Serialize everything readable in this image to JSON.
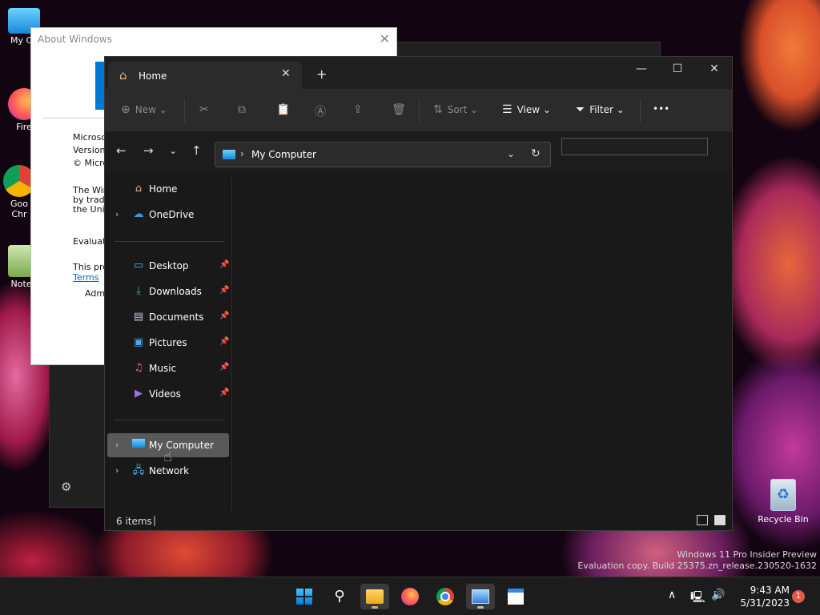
{
  "desktop": {
    "icons": [
      {
        "label": "My Co",
        "icon": "monitor-icon"
      },
      {
        "label": "Fire",
        "icon": "firefox-icon"
      },
      {
        "label": "Goo Chr",
        "icon": "chrome-icon"
      },
      {
        "label": "Notep",
        "icon": "notepad-icon"
      }
    ],
    "recycle_bin": "Recycle Bin"
  },
  "about_window": {
    "title": "About Windows",
    "lines": [
      "Microsof",
      "Version",
      "© Micro",
      "The Win",
      "by trade",
      "the Unit",
      "Evaluati",
      "This pro",
      "Terms",
      "Admi"
    ],
    "terms_link": "Terms"
  },
  "explorer": {
    "tab_label": "Home",
    "toolbar": {
      "new": "New",
      "sort": "Sort",
      "view": "View",
      "filter": "Filter",
      "more": "•••"
    },
    "address": {
      "path": "My Computer"
    },
    "sidebar": {
      "top": [
        {
          "label": "Home",
          "icon": "home-icon",
          "expandable": false
        },
        {
          "label": "OneDrive",
          "icon": "cloud-icon",
          "expandable": true
        }
      ],
      "quick_access": [
        {
          "label": "Desktop",
          "icon": "desktop-folder-icon"
        },
        {
          "label": "Downloads",
          "icon": "downloads-icon"
        },
        {
          "label": "Documents",
          "icon": "documents-icon"
        },
        {
          "label": "Pictures",
          "icon": "pictures-icon"
        },
        {
          "label": "Music",
          "icon": "music-icon"
        },
        {
          "label": "Videos",
          "icon": "videos-icon"
        }
      ],
      "locations": [
        {
          "label": "My Computer",
          "icon": "computer-icon",
          "selected": true
        },
        {
          "label": "Network",
          "icon": "network-icon",
          "selected": false
        }
      ]
    },
    "status": {
      "count": "6 items"
    }
  },
  "watermark": {
    "line1": "Windows 11 Pro Insider Preview",
    "line2": "Evaluation copy. Build 25375.zn_release.230520-1632"
  },
  "taskbar": {
    "apps": [
      "start-icon",
      "search-icon",
      "file-explorer-icon",
      "firefox-icon",
      "chrome-icon",
      "photos-icon",
      "notepad-icon"
    ],
    "clock_time": "9:43 AM",
    "clock_date": "5/31/2023",
    "notification_count": "1"
  },
  "colors": {
    "accent": "#0078d4",
    "explorer_bg": "#191919",
    "toolbar_bg": "#2b2b2b",
    "selected_item": "#595959"
  }
}
